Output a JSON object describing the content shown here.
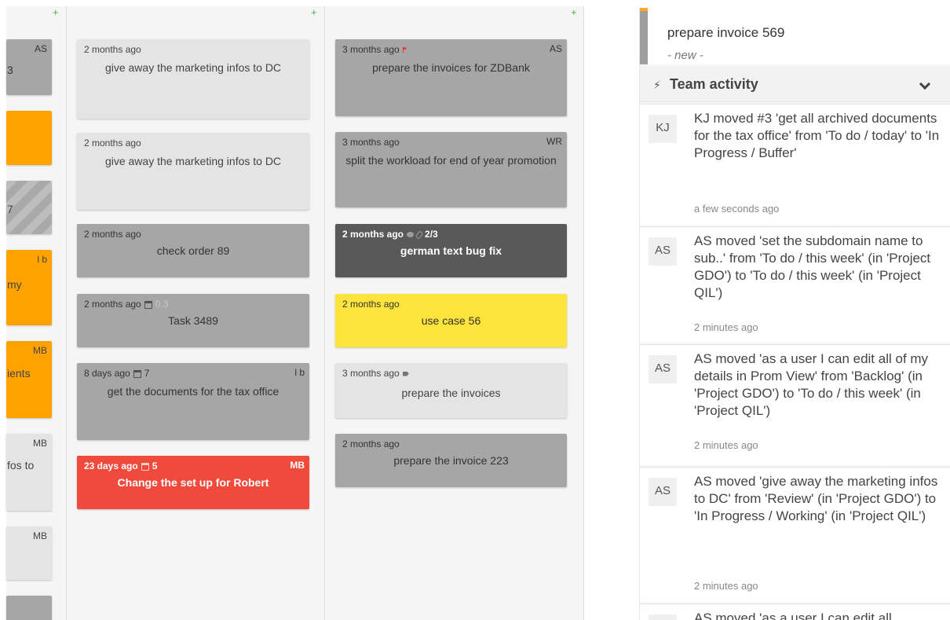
{
  "board": {
    "column0": {
      "cards": [
        {
          "initials": "AS",
          "fragment": "3"
        },
        {
          "initials": "",
          "fragment": ""
        },
        {
          "initials": "",
          "fragment": "7"
        },
        {
          "initials": "l b",
          "fragment": "my"
        },
        {
          "initials": "MB",
          "fragment": "ients"
        },
        {
          "initials": "MB",
          "fragment": "fos to"
        },
        {
          "initials": "MB",
          "fragment": ""
        }
      ]
    },
    "column1": {
      "add_label": "+",
      "cards": [
        {
          "time": "2 months ago",
          "title": "give away the marketing infos to DC"
        },
        {
          "time": "2 months ago",
          "title": "give away the marketing infos to DC"
        },
        {
          "time": "2 months ago",
          "title": "check order 89"
        },
        {
          "time": "2 months ago",
          "est": "0.3",
          "title": "Task 3489"
        },
        {
          "time": "8 days ago",
          "est": "7",
          "initials": "l b",
          "title": "get the documents for the tax office"
        },
        {
          "time": "23 days ago",
          "est": "5",
          "initials": "MB",
          "title": "Change the set up for Robert"
        }
      ]
    },
    "column2": {
      "add_label": "+",
      "cards": [
        {
          "time": "3 months ago",
          "initials": "AS",
          "title": "prepare the invoices for ZDBank"
        },
        {
          "time": "3 months ago",
          "initials": "WR",
          "title": "split the workload for end of year promotion"
        },
        {
          "time": "2 months ago",
          "checklist": "2/3",
          "title": "german text bug fix"
        },
        {
          "time": "2 months ago",
          "title": "use case 56"
        },
        {
          "time": "3 months ago",
          "title": "prepare the invoices"
        },
        {
          "time": "2 months ago",
          "title": "prepare the invoice 223"
        }
      ]
    },
    "column0_add": "+"
  },
  "panel": {
    "task_title": "prepare invoice 569",
    "task_status": "- new -",
    "team_title": "Team activity",
    "activities": [
      {
        "avatar": "KJ",
        "text": "KJ moved #3 'get all archived documents for the tax office' from 'To do / today' to 'In Progress / Buffer'",
        "time": "a few seconds ago"
      },
      {
        "avatar": "AS",
        "text": "AS moved 'set the subdomain name to sub..' from 'To do / this week' (in 'Project GDO') to 'To do / this week' (in 'Project QIL')",
        "time": "2 minutes ago"
      },
      {
        "avatar": "AS",
        "text": "AS moved 'as a user I can edit all of my details in Prom View' from 'Backlog' (in 'Project GDO') to 'To do / this week' (in 'Project QIL')",
        "time": "2 minutes ago"
      },
      {
        "avatar": "AS",
        "text": "AS moved 'give away the marketing infos to DC' from 'Review' (in 'Project GDO') to 'In Progress / Working' (in 'Project QIL')",
        "time": "2 minutes ago"
      },
      {
        "avatar": "AS",
        "text": "AS moved 'as a user I can edit all",
        "time": ""
      }
    ]
  },
  "colors": {
    "orange": "#ffa200",
    "red": "#f04a3d",
    "yellow": "#fde43c",
    "dark": "#595959",
    "gray": "#a6a6a6",
    "light": "#e4e4e4"
  }
}
